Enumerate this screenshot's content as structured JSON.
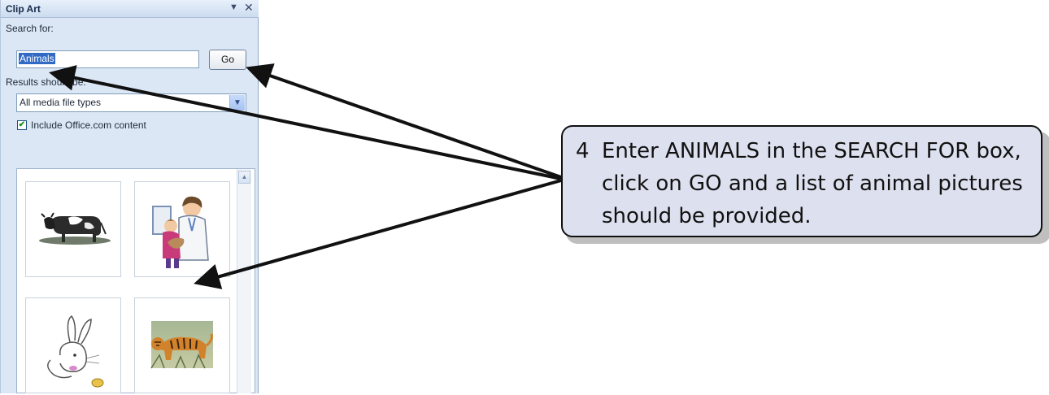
{
  "pane": {
    "title": "Clip Art",
    "menu_icon": "▼",
    "close_icon": "✕",
    "search_label": "Search for:",
    "search_value": "Animals",
    "go_label": "Go",
    "results_label": "Results should be:",
    "media_type_value": "All media file types",
    "include_label": "Include Office.com content",
    "include_checked": true,
    "clips": [
      {
        "icon": "cow-clipart"
      },
      {
        "icon": "veterinarian-clipart"
      },
      {
        "icon": "rabbit-clipart"
      },
      {
        "icon": "tiger-clipart"
      }
    ]
  },
  "callout": {
    "number": "4",
    "text": "Enter ANIMALS in the SEARCH FOR box, click on GO and a list of animal pictures should be provided."
  },
  "colors": {
    "selection": "#316ac5",
    "pane_bg": "#dce7f5",
    "callout_bg": "#dde1ef"
  }
}
